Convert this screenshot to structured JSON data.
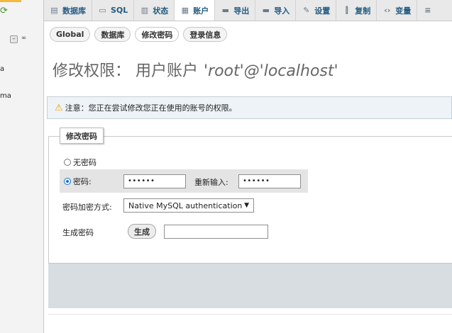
{
  "left_panel": {
    "tree_items": [
      "a",
      "ma"
    ]
  },
  "topnav": {
    "tabs": [
      {
        "label": "数据库",
        "icon": "database-icon",
        "glyph": "▤"
      },
      {
        "label": "SQL",
        "icon": "sql-icon",
        "glyph": "▭"
      },
      {
        "label": "状态",
        "icon": "status-icon",
        "glyph": "▥"
      },
      {
        "label": "账户",
        "icon": "accounts-icon",
        "glyph": "▦"
      },
      {
        "label": "导出",
        "icon": "export-icon",
        "glyph": "▬"
      },
      {
        "label": "导入",
        "icon": "import-icon",
        "glyph": "▬"
      },
      {
        "label": "设置",
        "icon": "settings-icon",
        "glyph": "✎"
      },
      {
        "label": "复制",
        "icon": "replication-icon",
        "glyph": "⫿"
      },
      {
        "label": "变量",
        "icon": "variables-icon",
        "glyph": "‹›"
      },
      {
        "label": "",
        "icon": "more-icon",
        "glyph": "≡"
      }
    ],
    "active_index": 3
  },
  "subtabs": [
    {
      "label": "Global"
    },
    {
      "label": "数据库"
    },
    {
      "label": "修改密码"
    },
    {
      "label": "登录信息"
    }
  ],
  "page": {
    "title": "修改权限：  用户账户",
    "account": "'root'@'localhost'"
  },
  "notice": {
    "text": "注意：您正在尝试修改您正在使用的账号的权限。"
  },
  "form": {
    "legend": "修改密码",
    "no_password_label": "无密码",
    "password_label": "密码:",
    "password_value": "••••••",
    "retype_label": "重新输入:",
    "retype_value": "••••••",
    "hashing_label": "密码加密方式:",
    "hashing_selected": "Native MySQL authentication",
    "generate_label": "生成密码",
    "generate_button": "生成"
  },
  "colors": {
    "nav_link": "#235a81",
    "radio_selected": "#1a6fd6",
    "warning": "#e6a200"
  }
}
